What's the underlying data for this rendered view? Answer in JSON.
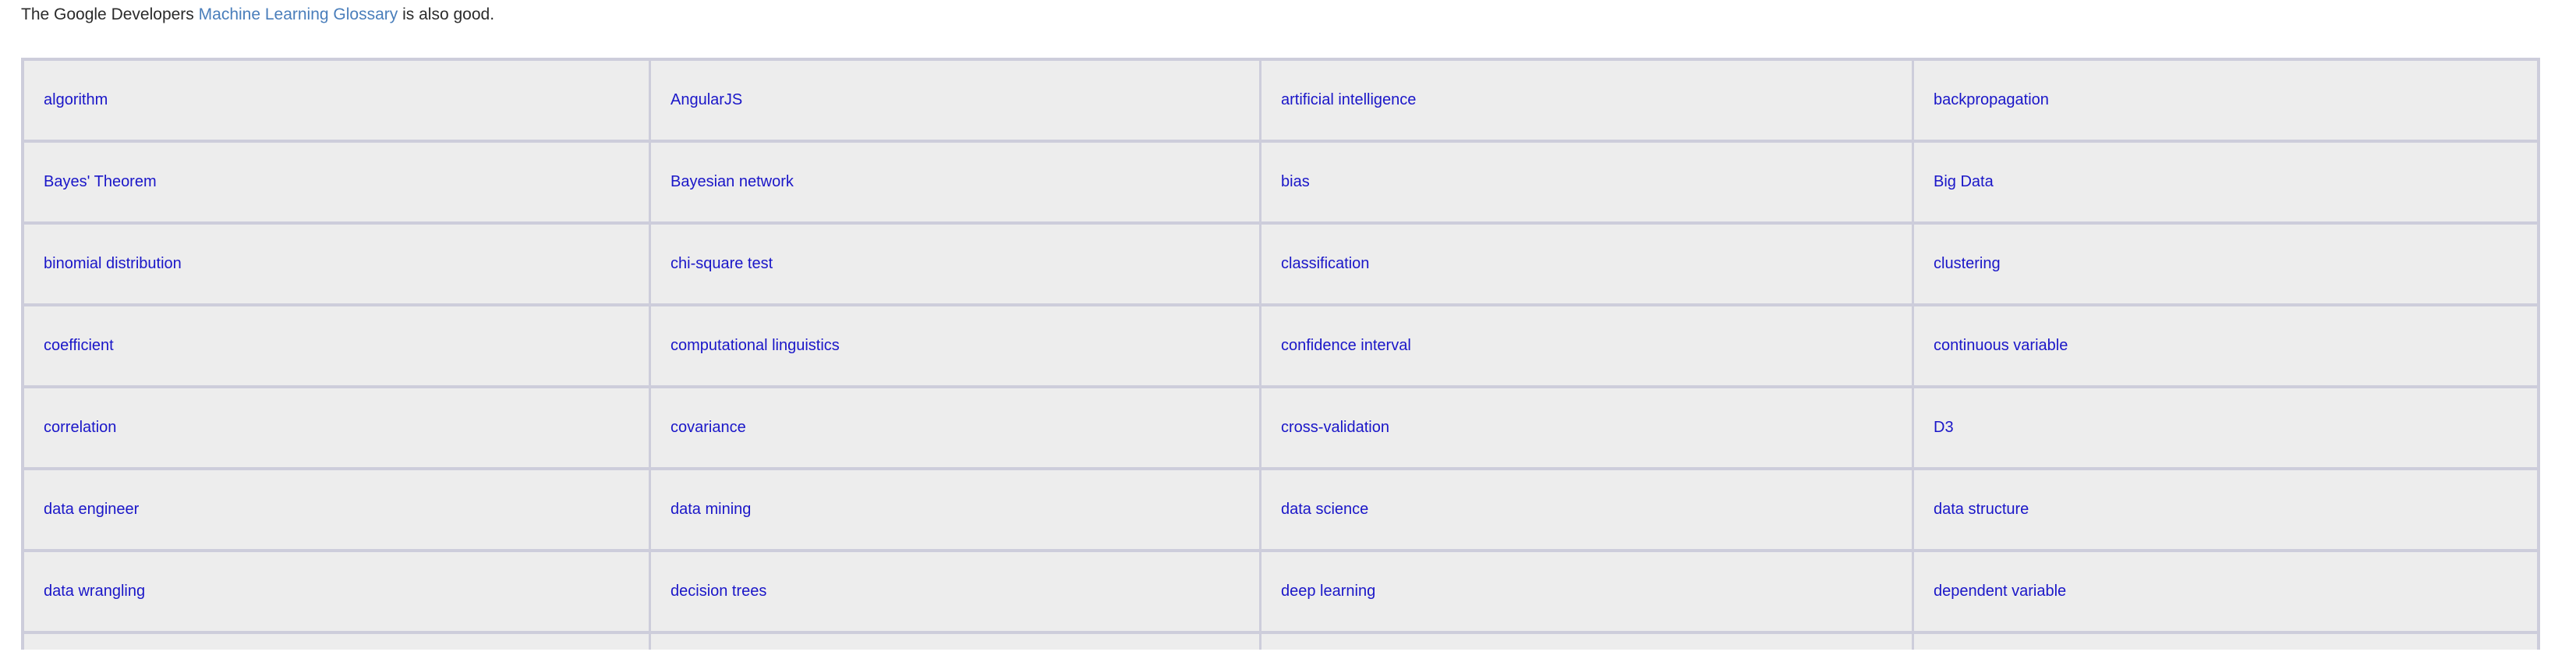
{
  "intro": {
    "before": "The Google Developers ",
    "link_text": "Machine Learning Glossary",
    "after": " is also good."
  },
  "colors": {
    "cell_background": "#ededed",
    "cell_border": "#cdcddb",
    "cell_link": "#1a16c8",
    "intro_link": "#4a7ebb",
    "intro_text": "#2b2b2b",
    "page_background": "#ffffff"
  },
  "glossary": {
    "columns": 4,
    "rows": [
      [
        "algorithm",
        "AngularJS",
        "artificial intelligence",
        "backpropagation"
      ],
      [
        "Bayes' Theorem",
        "Bayesian network",
        "bias",
        "Big Data"
      ],
      [
        "binomial distribution",
        "chi-square test",
        "classification",
        "clustering"
      ],
      [
        "coefficient",
        "computational linguistics",
        "confidence interval",
        "continuous variable"
      ],
      [
        "correlation",
        "covariance",
        "cross-validation",
        "D3"
      ],
      [
        "data engineer",
        "data mining",
        "data science",
        "data structure"
      ],
      [
        "data wrangling",
        "decision trees",
        "deep learning",
        "dependent variable"
      ],
      [
        "",
        "",
        "",
        ""
      ]
    ]
  }
}
